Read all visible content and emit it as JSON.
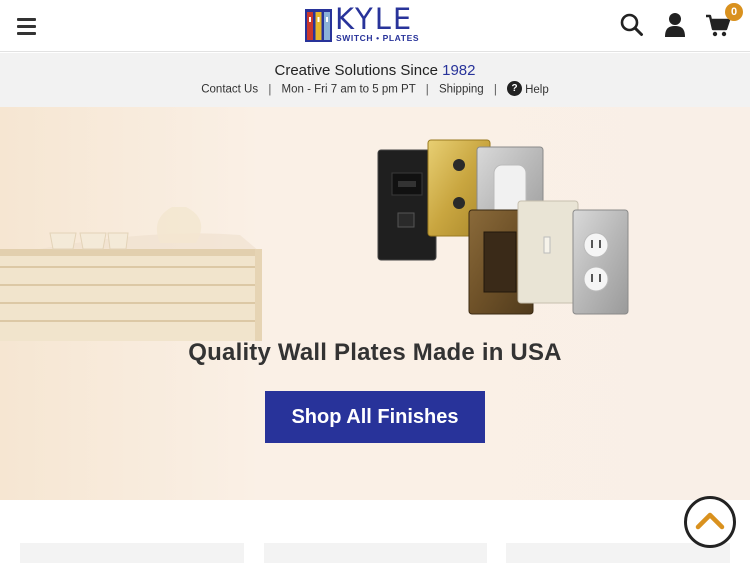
{
  "header": {
    "logo_word": "KYLE",
    "logo_sub": "SWITCH • PLATES",
    "cart_count": "0"
  },
  "infobar": {
    "tagline_prefix": "Creative Solutions Since ",
    "tagline_year": "1982",
    "contact_label": "Contact Us",
    "hours_label": "Mon - Fri 7 am to 5 pm PT",
    "shipping_label": "Shipping",
    "help_label": "Help",
    "separator": "|"
  },
  "hero": {
    "title": "Quality Wall Plates Made in USA",
    "cta_label": "Shop All Finishes"
  },
  "colors": {
    "brand": "#28339a",
    "badge": "#d9911e",
    "hero_bg": "#f9efe7"
  },
  "icons": [
    "menu-icon",
    "search-icon",
    "account-icon",
    "cart-icon",
    "help-icon",
    "chevron-up-icon"
  ]
}
